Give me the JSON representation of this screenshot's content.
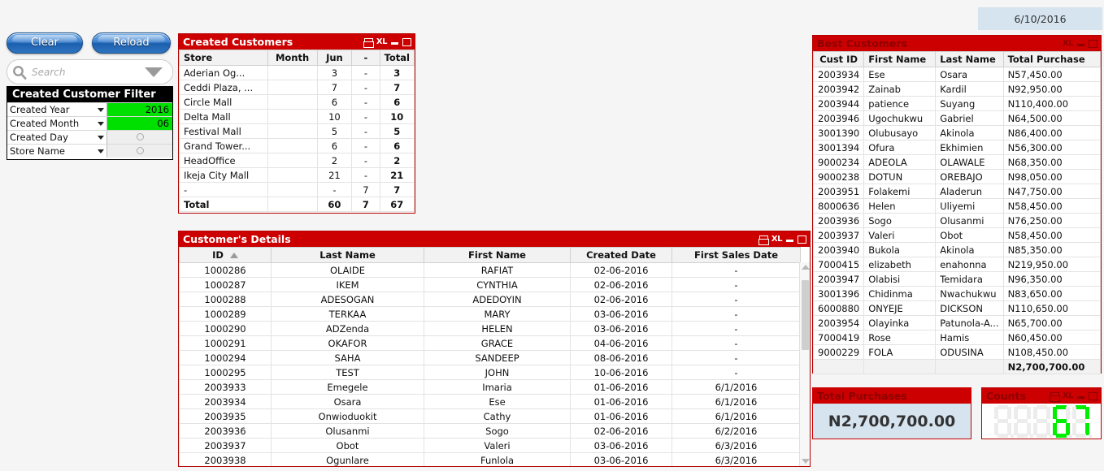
{
  "header": {
    "date": "6/10/2016"
  },
  "toolbar": {
    "clear_label": "Clear",
    "reload_label": "Reload",
    "search_placeholder": "Search"
  },
  "filter_panel": {
    "title": "Created Customer Filter",
    "rows": [
      {
        "label": "Created Year",
        "value": "2016",
        "selected": true
      },
      {
        "label": "Created Month",
        "value": "06",
        "selected": true
      },
      {
        "label": "Created Day",
        "value": "",
        "selected": false
      },
      {
        "label": "Store Name",
        "value": "",
        "selected": false
      }
    ]
  },
  "created_customers": {
    "title": "Created Customers",
    "icons": [
      "print-icon",
      "excel-export-icon",
      "minimize-icon",
      "maximize-icon"
    ],
    "headers": [
      "Store",
      "Month",
      "Jun",
      "-",
      "Total"
    ],
    "rows": [
      {
        "store": "Aderian Og...",
        "jun": "3",
        "dash": "-",
        "total": "3"
      },
      {
        "store": "Ceddi Plaza, ...",
        "jun": "7",
        "dash": "-",
        "total": "7"
      },
      {
        "store": "Circle Mall",
        "jun": "6",
        "dash": "-",
        "total": "6"
      },
      {
        "store": "Delta Mall",
        "jun": "10",
        "dash": "-",
        "total": "10"
      },
      {
        "store": "Festival Mall",
        "jun": "5",
        "dash": "-",
        "total": "5"
      },
      {
        "store": "Grand Tower...",
        "jun": "6",
        "dash": "-",
        "total": "6"
      },
      {
        "store": "HeadOffice",
        "jun": "2",
        "dash": "-",
        "total": "2"
      },
      {
        "store": "Ikeja City Mall",
        "jun": "21",
        "dash": "-",
        "total": "21"
      },
      {
        "store": "-",
        "jun": "-",
        "dash": "7",
        "total": "7"
      }
    ],
    "total_row": {
      "store": "Total",
      "jun": "60",
      "dash": "7",
      "total": "67"
    }
  },
  "customer_details": {
    "title": "Customer's Details",
    "icons": [
      "print-icon",
      "excel-export-icon",
      "minimize-icon",
      "maximize-icon"
    ],
    "headers": [
      "ID",
      "Last Name",
      "First Name",
      "Created Date",
      "First Sales Date"
    ],
    "sorted_column": "ID",
    "rows": [
      [
        "1000286",
        "OLAIDE",
        "RAFIAT",
        "02-06-2016",
        "-"
      ],
      [
        "1000287",
        "IKEM",
        "CYNTHIA",
        "02-06-2016",
        "-"
      ],
      [
        "1000288",
        "ADESOGAN",
        "ADEDOYIN",
        "02-06-2016",
        "-"
      ],
      [
        "1000289",
        "TERKAA",
        "MARY",
        "03-06-2016",
        "-"
      ],
      [
        "1000290",
        "ADZenda",
        "HELEN",
        "03-06-2016",
        "-"
      ],
      [
        "1000291",
        "OKAFOR",
        "GRACE",
        "04-06-2016",
        "-"
      ],
      [
        "1000294",
        "SAHA",
        "SANDEEP",
        "08-06-2016",
        "-"
      ],
      [
        "1000295",
        "TEST",
        "JOHN",
        "10-06-2016",
        "-"
      ],
      [
        "2003933",
        "Emegele",
        "Imaria",
        "01-06-2016",
        "6/1/2016"
      ],
      [
        "2003934",
        "Osara",
        "Ese",
        "01-06-2016",
        "6/1/2016"
      ],
      [
        "2003935",
        "Onwioduokit",
        "Cathy",
        "01-06-2016",
        "6/1/2016"
      ],
      [
        "2003936",
        "Olusanmi",
        "Sogo",
        "02-06-2016",
        "6/2/2016"
      ],
      [
        "2003937",
        "Obot",
        "Valeri",
        "03-06-2016",
        "6/3/2016"
      ],
      [
        "2003938",
        "Ogunlare",
        "Funlola",
        "03-06-2016",
        "6/3/2016"
      ]
    ]
  },
  "best_customers": {
    "title": "Best Customers",
    "icons": [
      "excel-export-icon",
      "minimize-icon",
      "maximize-icon"
    ],
    "headers": [
      "Cust ID",
      "First Name",
      "Last Name",
      "Total Purchase"
    ],
    "rows": [
      [
        "2003934",
        "Ese",
        "Osara",
        "N57,450.00"
      ],
      [
        "2003942",
        "Zainab",
        "Kardil",
        "N92,950.00"
      ],
      [
        "2003944",
        "patience",
        "Suyang",
        "N110,400.00"
      ],
      [
        "2003946",
        "Ugochukwu",
        "Gabriel",
        "N64,500.00"
      ],
      [
        "3001390",
        "Olubusayo",
        "Akinola",
        "N86,400.00"
      ],
      [
        "3001394",
        "Ofura",
        "Ekhimien",
        "N56,300.00"
      ],
      [
        "9000234",
        "ADEOLA",
        "OLAWALE",
        "N68,350.00"
      ],
      [
        "9000238",
        "DOTUN",
        "OREBAJO",
        "N98,050.00"
      ],
      [
        "2003951",
        "Folakemi",
        "Aladerun",
        "N47,750.00"
      ],
      [
        "8000636",
        "Helen",
        "Uliyemi",
        "N58,450.00"
      ],
      [
        "2003936",
        "Sogo",
        "Olusanmi",
        "N76,250.00"
      ],
      [
        "2003937",
        "Valeri",
        "Obot",
        "N58,450.00"
      ],
      [
        "2003940",
        "Bukola",
        "Akinola",
        "N85,350.00"
      ],
      [
        "7000415",
        "elizabeth",
        "enahonna",
        "N219,950.00"
      ],
      [
        "2003947",
        "Olabisi",
        "Temidara",
        "N96,350.00"
      ],
      [
        "3001396",
        "Chidinma",
        "Nwachukwu",
        "N83,650.00"
      ],
      [
        "6000880",
        "ONYEJE",
        "DICKSON",
        "N110,650.00"
      ],
      [
        "2003954",
        "Olayinka",
        "Patunola-A...",
        "N65,700.00"
      ],
      [
        "7000419",
        "Rose",
        "Hamis",
        "N60,450.00"
      ],
      [
        "9000229",
        "FOLA",
        "ODUSINA",
        "N108,450.00"
      ]
    ],
    "total_row": [
      "",
      "",
      "",
      "N2,700,700.00"
    ]
  },
  "total_purchases": {
    "title": "Total Purchases",
    "value": "N2,700,700.00"
  },
  "counts": {
    "title": "Counts",
    "icons": [
      "print-icon",
      "excel-export-icon",
      "minimize-icon",
      "maximize-icon"
    ],
    "value": "67",
    "digit_slots": 5,
    "lit_color": "#00ee00",
    "unlit_color": "#ececec"
  },
  "colors": {
    "caption_red": "#cc0000",
    "border_red": "#b50000",
    "selected_green": "#00e000",
    "kpi_blue": "#d6e4f0",
    "page_bg": "#f5f5f5"
  }
}
